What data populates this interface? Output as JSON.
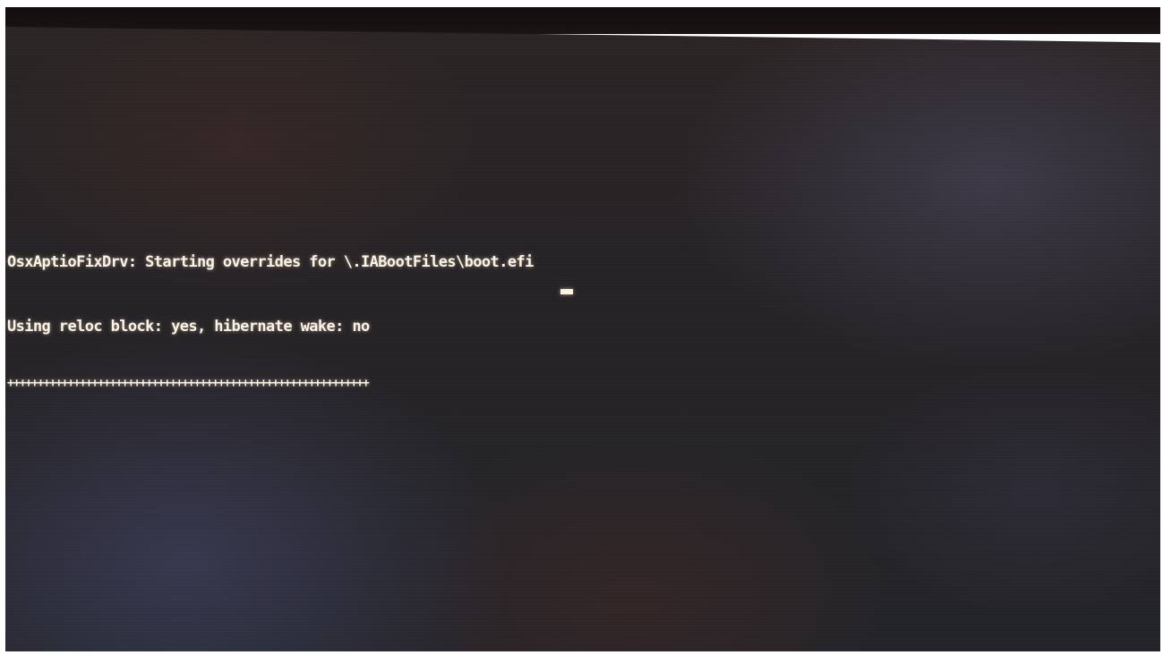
{
  "console": {
    "lines": [
      "OsxAptioFixDrv: Starting overrides for \\.IABootFiles\\boot.efi",
      "Using reloc block: yes, hibernate wake: no"
    ],
    "progress": "++++++++++++++++++++++++++++++++++++++++++++++++++++++++++++"
  },
  "colors": {
    "text": "#fff4e4",
    "background": "#262326"
  }
}
